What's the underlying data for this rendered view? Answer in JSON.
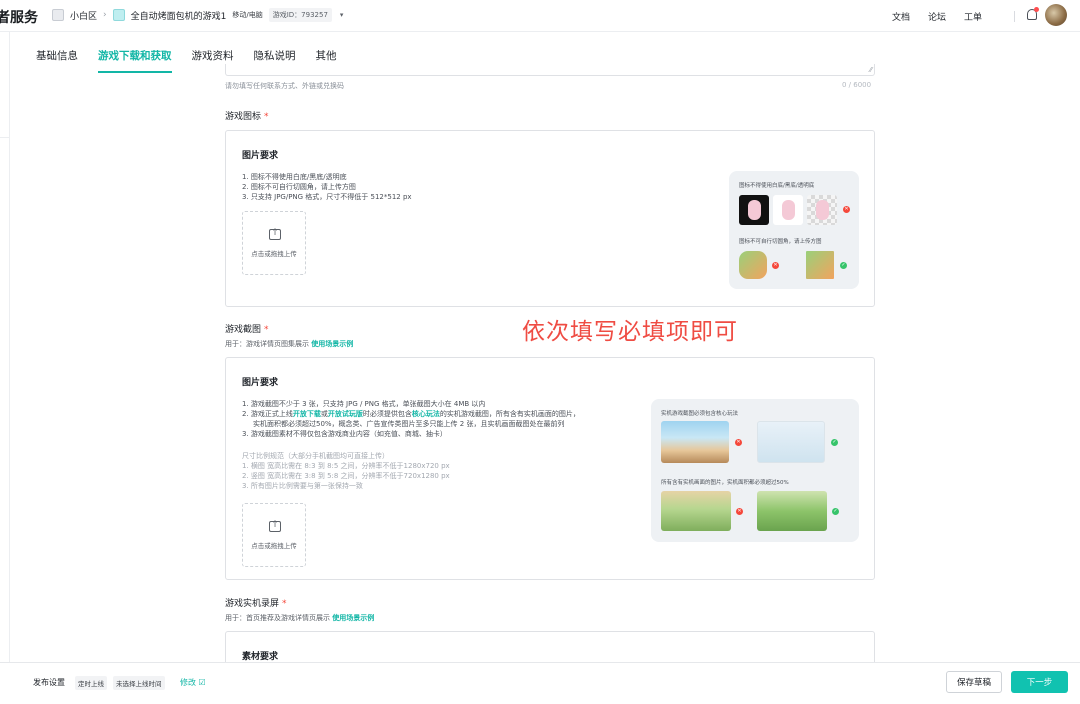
{
  "header": {
    "brand": "者服务",
    "breadcrumb": {
      "team": "小白区",
      "game": "全自动烤面包机的游戏1",
      "platform": "移动/电脑",
      "game_id": "游戏ID：793257",
      "caret": "▾"
    },
    "links": [
      "文档",
      "论坛",
      "工单"
    ]
  },
  "tabs": [
    "基础信息",
    "游戏下载和获取",
    "游戏资料",
    "隐私说明",
    "其他"
  ],
  "active_tab_index": 1,
  "intro_field": {
    "hint": "请勿填写任何联系方式、外链或兑换码",
    "counter": "0 / 6000"
  },
  "icon_field": {
    "label": "游戏图标",
    "required_mark": "*",
    "card_title": "图片要求",
    "requirements": [
      "1. 图标不得使用白底/黑底/透明底",
      "2. 图标不可自行切圆角，请上传方图",
      "3. 只支持 JPG/PNG 格式，尺寸不得低于 512*512 px"
    ],
    "upload_text": "点击或拖拽上传",
    "example_captions": [
      "图标不得使用白底/黑底/透明底",
      "图标不可自行切圆角，请上传方图"
    ]
  },
  "annotation": "依次填写必填项即可",
  "screenshot_field": {
    "label": "游戏截图",
    "required_mark": "*",
    "usage_prefix": "用于：游戏详情页图集展示",
    "usage_link": "使用场景示例",
    "card_title": "图片要求",
    "req1": "1. 游戏截图不少于 3 张，只支持 JPG / PNG 格式，单张截图大小在 4MB 以内",
    "req2_a": "2. 游戏正式上线",
    "req2_hl1": "开放下载",
    "req2_b": "或",
    "req2_hl2": "开放试玩版",
    "req2_c": "时必须提供包含",
    "req2_hl3": "核心玩法",
    "req2_d": "的实机游戏截图，所有含有实机画面的图片，",
    "req2_line2": "实机面积都必须超过50%，概念类、广告宣传类图片至多只能上传 2 张，且实机画面截图处在最前列",
    "req3": "3. 游戏截图素材不得仅包含游戏商业内容（如充值、商城、抽卡）",
    "size_title": "尺寸比例规范（大部分手机截图均可直接上传）",
    "size_rules": [
      "1. 横图 宽高比需在 8:3 到 8:5 之间，分辨率不低于1280x720 px",
      "2. 竖图 宽高比需在 3:8 到 5:8 之间，分辨率不低于720x1280 px",
      "3. 所有图片比例需要与第一张保持一致"
    ],
    "upload_text": "点击或拖拽上传",
    "example_captions": [
      "实机游戏截图必须包含核心玩法",
      "所有含有实机画面的图片，实机面积都必须超过50%"
    ]
  },
  "recording_field": {
    "label": "游戏实机录屏",
    "required_mark": "*",
    "usage_prefix": "用于：首页推荐及游戏详情页展示",
    "usage_link": "使用场景示例",
    "card_title": "素材要求"
  },
  "bottom_bar": {
    "publish_label": "发布设置",
    "tags": [
      "定时上线",
      "未选择上线时间"
    ],
    "edit": "修改 ☑",
    "save_draft": "保存草稿",
    "next": "下一步"
  },
  "colors": {
    "accent": "#12b6a6",
    "primary_button": "#11c2b0",
    "required": "#f5483b",
    "annotation": "#ef4c43"
  }
}
